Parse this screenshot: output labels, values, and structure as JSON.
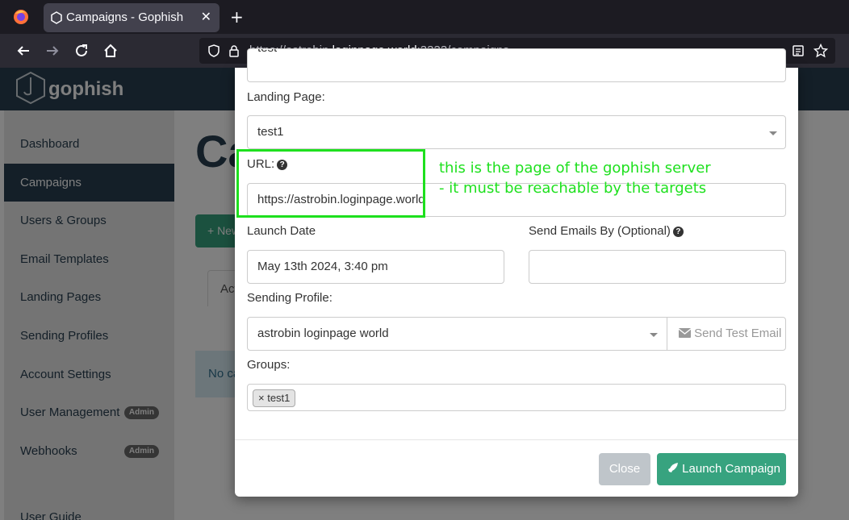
{
  "browser": {
    "tab_title": "Campaigns - Gophish",
    "url_prefix": "https://astrobin.",
    "url_domain": "loginpage.world",
    "url_suffix": ":3333/campaigns"
  },
  "app": {
    "brand": "gophish",
    "page_title": "Ca",
    "new_button_label": "+ New Campaign",
    "bg_tab_label": "Active Campaigns",
    "alert_text": "No campaigns created yet."
  },
  "sidebar": {
    "items": [
      {
        "label": "Dashboard"
      },
      {
        "label": "Campaigns"
      },
      {
        "label": "Users & Groups"
      },
      {
        "label": "Email Templates"
      },
      {
        "label": "Landing Pages"
      },
      {
        "label": "Sending Profiles"
      },
      {
        "label": "Account Settings"
      },
      {
        "label": "User Management",
        "badge": "Admin"
      },
      {
        "label": "Webhooks",
        "badge": "Admin"
      }
    ],
    "user_guide": "User Guide"
  },
  "modal": {
    "email_template_value": "test",
    "landing_page_label": "Landing Page:",
    "landing_page_value": "test1",
    "url_label": "URL:",
    "url_value": "https://astrobin.loginpage.world",
    "launch_date_label": "Launch Date",
    "launch_date_value": "May 13th 2024, 3:40 pm",
    "send_by_label": "Send Emails By (Optional)",
    "send_by_value": "",
    "sending_profile_label": "Sending Profile:",
    "sending_profile_value": "astrobin loginpage world",
    "send_test_label": "Send Test Email",
    "groups_label": "Groups:",
    "group_tag": "test1",
    "close_label": "Close",
    "launch_label": "Launch Campaign"
  },
  "annotation": {
    "line1": "this is the page of the gophish server",
    "line2": "- it must be reachable by the targets"
  },
  "colors": {
    "annotation": "#1ee01e",
    "primary": "#37a37f",
    "header": "#283f50"
  }
}
